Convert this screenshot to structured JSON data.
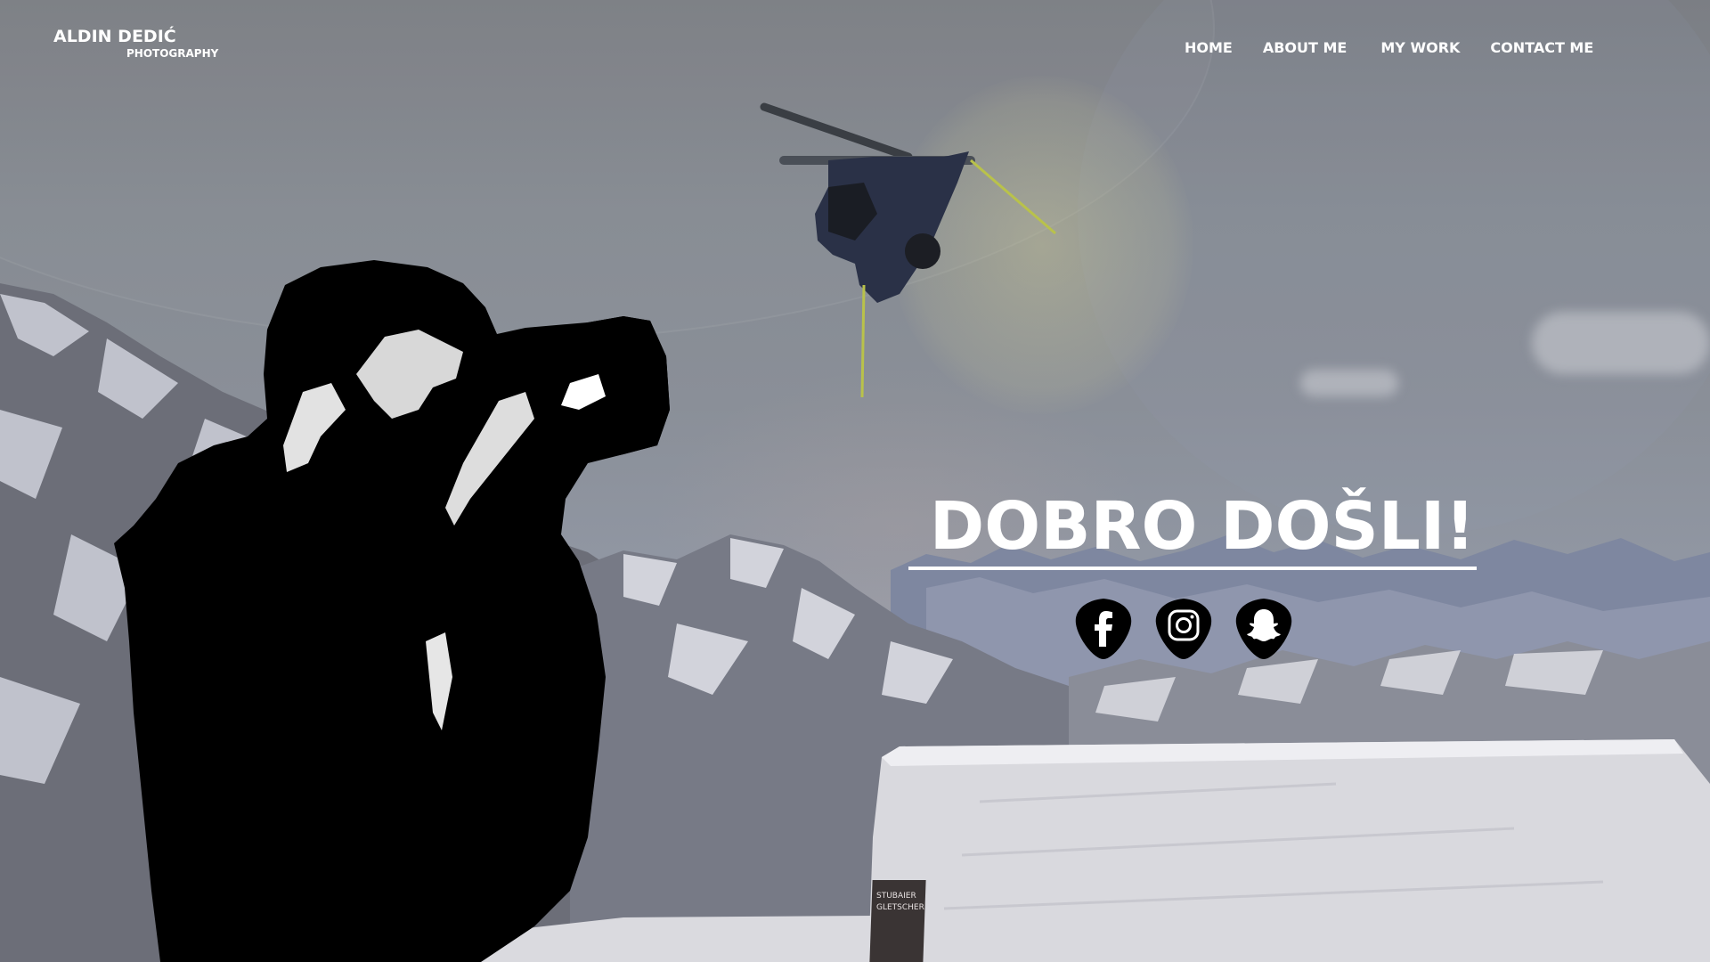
{
  "header": {
    "logo_name": "ALDIN DEDIĆ",
    "logo_sub": "PHOTOGRAPHY"
  },
  "nav": {
    "items": [
      {
        "label": "HOME"
      },
      {
        "label": "ABOUT ME"
      },
      {
        "label": "MY WORK"
      },
      {
        "label": "CONTACT ME"
      }
    ]
  },
  "hero": {
    "title": "DOBRO DOŠLI!"
  },
  "socials": [
    {
      "name": "facebook-icon"
    },
    {
      "name": "instagram-icon"
    },
    {
      "name": "snapchat-icon"
    }
  ],
  "scene": {
    "sign_text": "STUBAIER GLETSCHER"
  },
  "colors": {
    "text": "#ffffff",
    "icon_bg": "#000000"
  }
}
